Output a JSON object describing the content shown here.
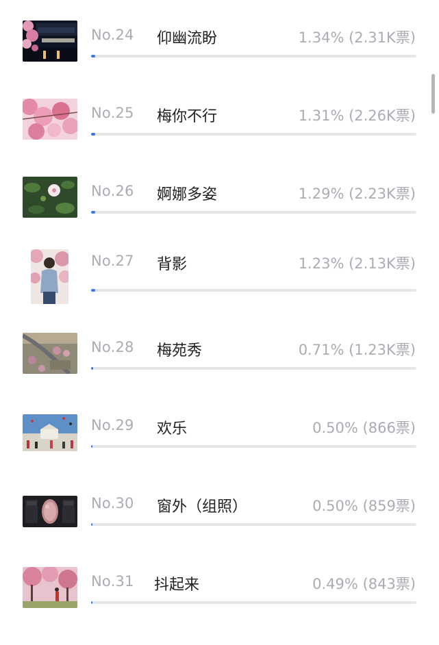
{
  "ranking": [
    {
      "rank": "No.24",
      "title": "仰幽流盼",
      "share": "1.34% (2.31K票)",
      "percent": 1.34,
      "thumb": "night-gate-photo"
    },
    {
      "rank": "No.25",
      "title": "梅你不行",
      "share": "1.31% (2.26K票)",
      "percent": 1.31,
      "thumb": "pink-blossom-photo"
    },
    {
      "rank": "No.26",
      "title": "婀娜多姿",
      "share": "1.29% (2.23K票)",
      "percent": 1.29,
      "thumb": "single-flower-photo"
    },
    {
      "rank": "No.27",
      "title": "背影",
      "share": "1.23% (2.13K票)",
      "percent": 1.23,
      "thumb": "girl-back-photo"
    },
    {
      "rank": "No.28",
      "title": "梅苑秀",
      "share": "0.71% (1.23K票)",
      "percent": 0.71,
      "thumb": "aerial-garden-photo"
    },
    {
      "rank": "No.29",
      "title": "欢乐",
      "share": "0.50% (866票)",
      "percent": 0.5,
      "thumb": "kites-crowd-photo"
    },
    {
      "rank": "No.30",
      "title": "窗外（组照）",
      "share": "0.50% (859票)",
      "percent": 0.5,
      "thumb": "window-frame-photo"
    },
    {
      "rank": "No.31",
      "title": "抖起来",
      "share": "0.49% (843票)",
      "percent": 0.49,
      "thumb": "plum-orchard-photo"
    }
  ],
  "colors": {
    "accent": "#3b78e7",
    "track": "#e6e6ea",
    "muted": "#a9adb3",
    "text": "#222222"
  }
}
